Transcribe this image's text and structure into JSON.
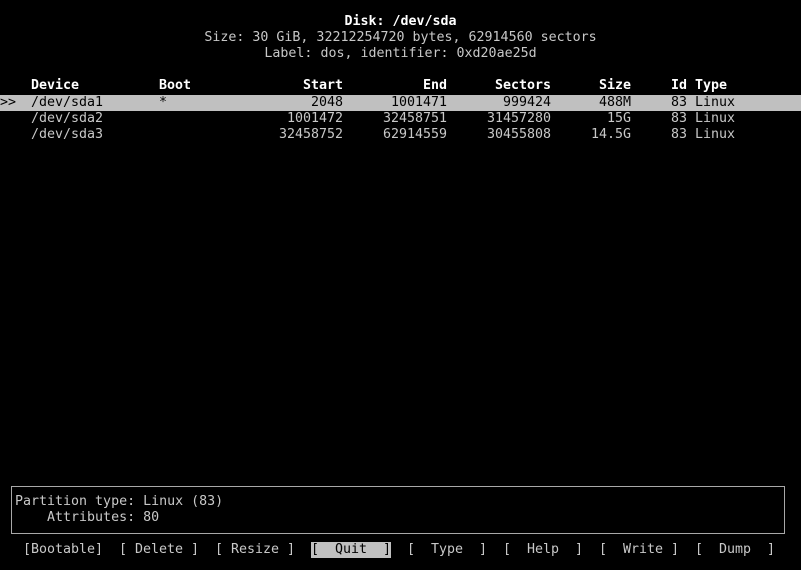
{
  "header": {
    "title": "Disk: /dev/sda",
    "size_line": "Size: 30 GiB, 32212254720 bytes, 62914560 sectors",
    "label_line": "Label: dos, identifier: 0xd20ae25d"
  },
  "columns": {
    "device": "Device",
    "boot": "Boot",
    "start": "Start",
    "end": "End",
    "sectors": "Sectors",
    "size": "Size",
    "id": "Id",
    "type": "Type"
  },
  "selection_marker": ">>",
  "partitions": [
    {
      "device": "/dev/sda1",
      "boot": "*",
      "start": "2048",
      "end": "1001471",
      "sectors": "999424",
      "size": "488M",
      "id": "83",
      "type": "Linux"
    },
    {
      "device": "/dev/sda2",
      "boot": "",
      "start": "1001472",
      "end": "32458751",
      "sectors": "31457280",
      "size": "15G",
      "id": "83",
      "type": "Linux"
    },
    {
      "device": "/dev/sda3",
      "boot": "",
      "start": "32458752",
      "end": "62914559",
      "sectors": "30455808",
      "size": "14.5G",
      "id": "83",
      "type": "Linux"
    }
  ],
  "info": {
    "partition_type": "Partition type: Linux (83)",
    "attributes": "    Attributes: 80"
  },
  "menu": {
    "bootable": "[Bootable]",
    "delete": "[ Delete ]",
    "resize": "[ Resize ]",
    "quit": "[  Quit  ]",
    "type": "[  Type  ]",
    "help": "[  Help  ]",
    "write": "[  Write ]",
    "dump": "[  Dump  ]"
  }
}
